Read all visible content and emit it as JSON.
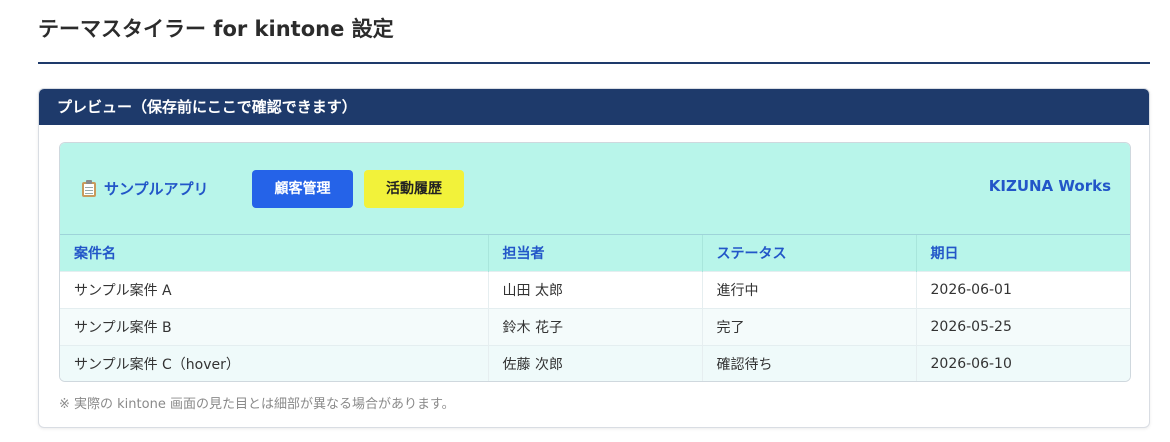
{
  "page": {
    "title": "テーマスタイラー for kintone 設定"
  },
  "preview_card": {
    "header": "プレビュー（保存前にここで確認できます）",
    "app": {
      "icon": "clipboard-icon",
      "name": "サンプルアプリ",
      "buttons": [
        {
          "label": "顧客管理",
          "color": "#2563e8"
        },
        {
          "label": "活動履歴",
          "color": "#f2f23a"
        }
      ],
      "brand": "KIZUNA Works"
    },
    "table": {
      "columns": [
        "案件名",
        "担当者",
        "ステータス",
        "期日"
      ],
      "rows": [
        [
          "サンプル案件 A",
          "山田 太郎",
          "進行中",
          "2026-06-01"
        ],
        [
          "サンプル案件 B",
          "鈴木 花子",
          "完了",
          "2026-05-25"
        ],
        [
          "サンプル案件 C（hover）",
          "佐藤 次郎",
          "確認待ち",
          "2026-06-10"
        ]
      ]
    },
    "note": "※ 実際の kintone 画面の見た目とは細部が異なる場合があります。"
  },
  "colors": {
    "header_navy": "#1e3a6b",
    "preview_bg": "#b8f5ea",
    "accent_blue": "#2256c8"
  }
}
